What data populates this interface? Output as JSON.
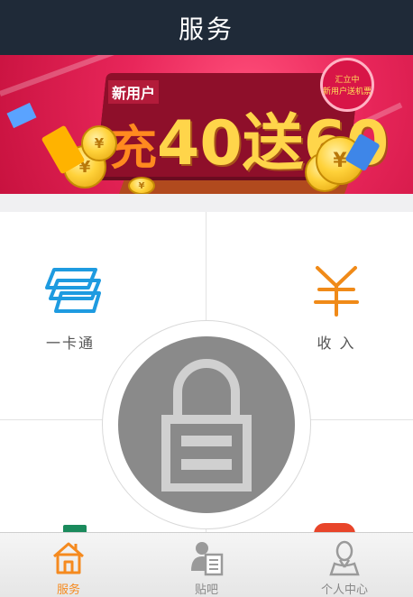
{
  "header": {
    "title": "服务"
  },
  "banner": {
    "tag": "新用户",
    "headline_a": "充",
    "headline_b": "40送60",
    "badge_line1": "汇立中",
    "badge_line2": "新用户送机票",
    "coin_symbol": "¥"
  },
  "tiles": [
    {
      "label": "一卡通",
      "icon": "card-stack-icon"
    },
    {
      "label": "收 入",
      "icon": "yen-icon"
    }
  ],
  "overlay": {
    "icon": "lock-icon"
  },
  "tabbar": {
    "active_color": "#f58a1f",
    "items": [
      {
        "label": "服务",
        "icon": "home-icon",
        "active": true
      },
      {
        "label": "贴吧",
        "icon": "forum-icon",
        "active": false
      },
      {
        "label": "个人中心",
        "icon": "profile-icon",
        "active": false
      }
    ]
  }
}
